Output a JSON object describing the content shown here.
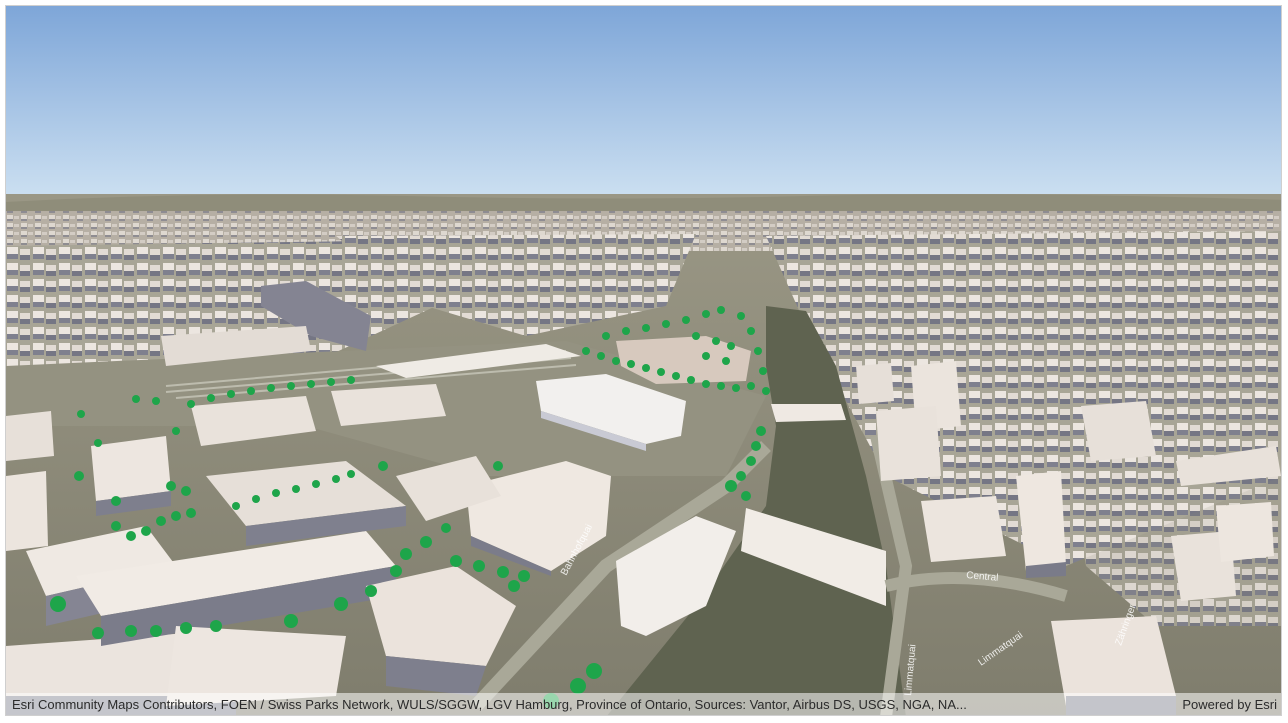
{
  "map": {
    "view": "3D scene",
    "colors": {
      "sky_top": "#7ea6d8",
      "sky_bottom": "#cfe2f2",
      "ground": "#8c8a78",
      "river": "#5f6350",
      "building": "#e8e2dc",
      "building_shadow": "#7e7f8e",
      "tree": "#1ea54a",
      "road": "#a9a898"
    },
    "street_labels": {
      "bahnhofquai": "Bahnhofquai",
      "limmatquai_left": "Limmatquai",
      "limmatquai_right": "Limmatquai",
      "central": "Central",
      "zahringer": "Zähringer"
    }
  },
  "attribution": {
    "credits": "Esri Community Maps Contributors, FOEN / Swiss Parks Network, WULS/SGGW, LGV Hamburg, Province of Ontario, Sources: Vantor, Airbus DS, USGS, NGA, NA...",
    "powered_by": "Powered by Esri"
  }
}
